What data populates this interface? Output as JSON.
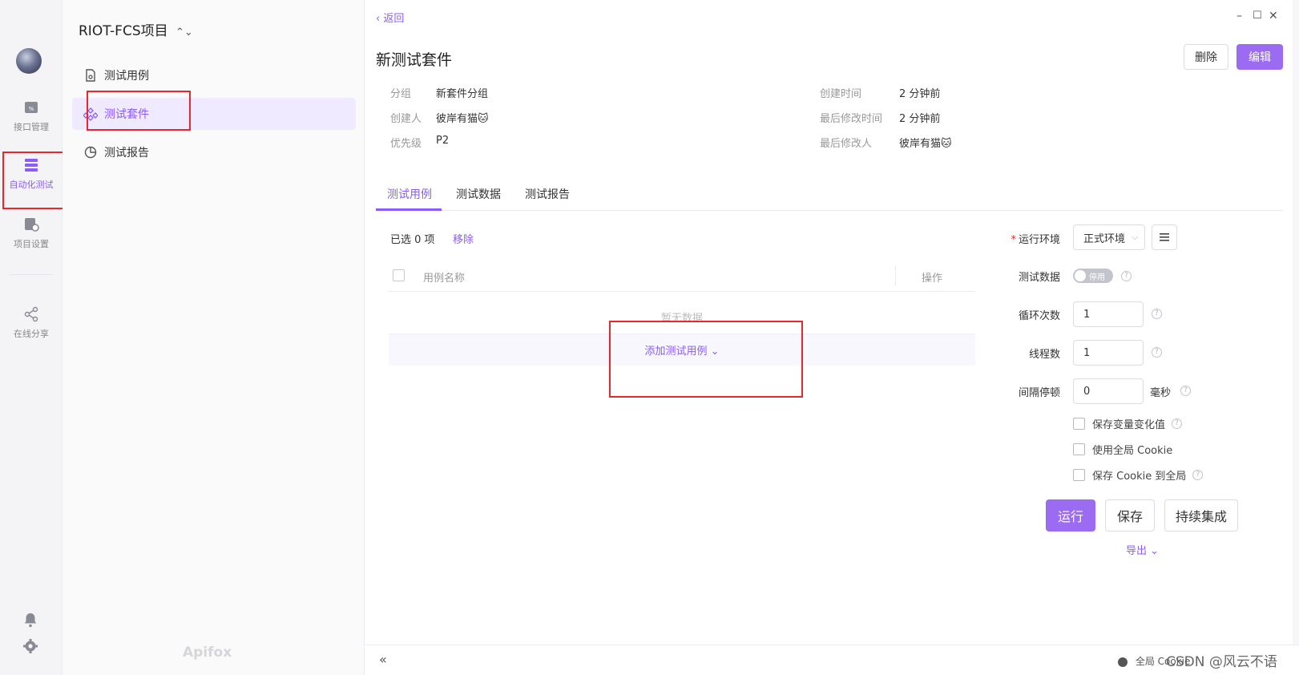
{
  "rail": {
    "items": [
      {
        "label": "接口管理",
        "icon": "api-icon"
      },
      {
        "label": "自动化测试",
        "icon": "automation-icon"
      },
      {
        "label": "项目设置",
        "icon": "settings-doc-icon"
      },
      {
        "label": "在线分享",
        "icon": "share-icon"
      }
    ]
  },
  "sidebar": {
    "project_name": "RIOT-FCS项目",
    "project_chevron": "⌃⌄",
    "items": [
      {
        "label": "测试用例"
      },
      {
        "label": "测试套件"
      },
      {
        "label": "测试报告"
      }
    ],
    "brand": "Apifox"
  },
  "main": {
    "back": "‹ 返回",
    "title": "新测试套件",
    "delete_label": "删除",
    "edit_label": "编辑",
    "meta": {
      "group_label": "分组",
      "group_value": "新套件分组",
      "creator_label": "创建人",
      "creator_value": "彼岸有猫🐱",
      "priority_label": "优先级",
      "priority_value": "P2",
      "created_label": "创建时间",
      "created_value": "2 分钟前",
      "modified_label": "最后修改时间",
      "modified_value": "2 分钟前",
      "modifier_label": "最后修改人",
      "modifier_value": "彼岸有猫🐱"
    },
    "tabs": [
      {
        "label": "测试用例"
      },
      {
        "label": "测试数据"
      },
      {
        "label": "测试报告"
      }
    ],
    "selected_text": "已选 0 项",
    "remove_label": "移除",
    "table": {
      "col_name": "用例名称",
      "col_action": "操作",
      "empty_text": "暂无数据",
      "add_label": "添加测试用例 ⌄"
    }
  },
  "form": {
    "env_label": "运行环境",
    "env_value": "正式环境",
    "data_label": "测试数据",
    "data_toggle": "停用",
    "loop_label": "循环次数",
    "loop_value": "1",
    "thread_label": "线程数",
    "thread_value": "1",
    "interval_label": "间隔停顿",
    "interval_value": "0",
    "interval_unit": "毫秒",
    "opt_save_var": "保存变量变化值",
    "opt_global_cookie": "使用全局 Cookie",
    "opt_save_cookie": "保存 Cookie 到全局",
    "run_label": "运行",
    "save_label": "保存",
    "ci_label": "持续集成",
    "export_label": "导出 ⌄"
  },
  "footer": {
    "collapse": "«",
    "global_cookie": "全局 Cookie",
    "watermark": "CSDN @风云不语"
  },
  "colors": {
    "accent": "#8b5cf6",
    "highlight_box": "#e8262b"
  }
}
